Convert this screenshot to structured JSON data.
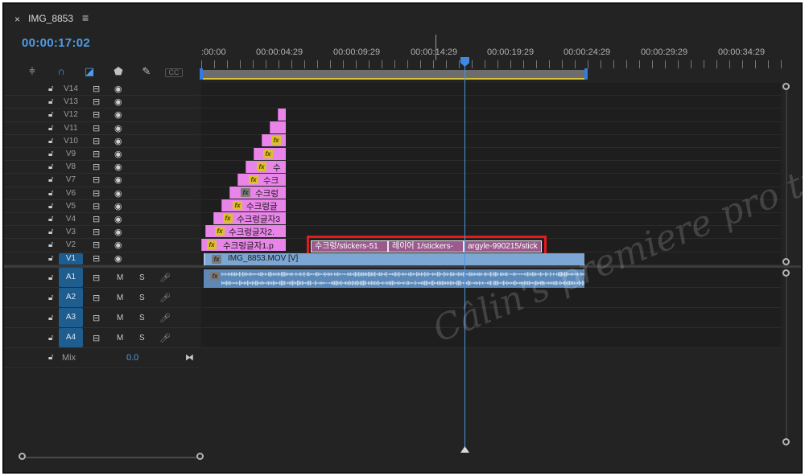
{
  "panel": {
    "close": "×",
    "title": "IMG_8853",
    "menu": "≡"
  },
  "timecode": "00:00:17:02",
  "toolbar": {
    "tools": [
      "snap-insert-icon",
      "magnet-icon",
      "linked-selection-icon",
      "marker-icon",
      "wrench-icon",
      "captions-icon"
    ]
  },
  "ruler": {
    "labels": [
      ":00:00",
      "00:00:04:29",
      "00:00:09:29",
      "00:00:14:29",
      "00:00:19:29",
      "00:00:24:29",
      "00:00:29:29",
      "00:00:34:29"
    ]
  },
  "video_tracks": [
    {
      "name": "V14"
    },
    {
      "name": "V13"
    },
    {
      "name": "V12"
    },
    {
      "name": "V11"
    },
    {
      "name": "V10"
    },
    {
      "name": "V9"
    },
    {
      "name": "V8"
    },
    {
      "name": "V7"
    },
    {
      "name": "V6"
    },
    {
      "name": "V5"
    },
    {
      "name": "V4"
    },
    {
      "name": "V3"
    },
    {
      "name": "V2"
    },
    {
      "name": "V1"
    }
  ],
  "audio_tracks": [
    {
      "name": "A1",
      "m": "M",
      "s": "S"
    },
    {
      "name": "A2",
      "m": "M",
      "s": "S"
    },
    {
      "name": "A3",
      "m": "M",
      "s": "S"
    },
    {
      "name": "A4",
      "m": "M",
      "s": "S"
    }
  ],
  "mix": {
    "label": "Mix",
    "value": "0.0"
  },
  "clips": {
    "v6": "수크렁",
    "v7": "수크",
    "v8": "수",
    "v5": "수크렁글",
    "v4": "수크렁글자3",
    "v3": "수크렁글자2.",
    "v2": "수크렁글자1.p"
  },
  "selected_segments": [
    "수크렁/stickers-51",
    "레이어 1/stickers-",
    "argyle-990215/stick"
  ],
  "video_clip": "IMG_8853.MOV [V]",
  "watermark": "Câlin's premiere pro tutorials"
}
